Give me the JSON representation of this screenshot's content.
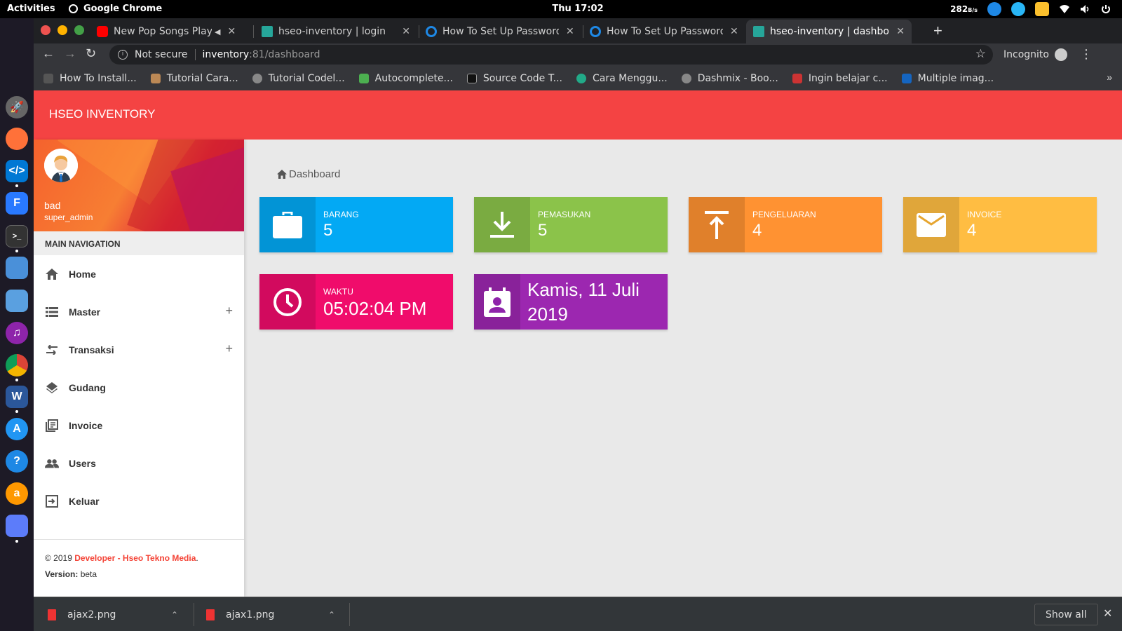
{
  "topbar": {
    "activities": "Activities",
    "app_name": "Google Chrome",
    "clock": "Thu 17:02",
    "net_speed": "282",
    "net_unit": "B/s"
  },
  "dock": {
    "apps": [
      "launcher-icon",
      "firefox-icon",
      "vscode-icon",
      "fman-icon",
      "terminal-icon",
      "screenshot-icon",
      "image-viewer-icon",
      "music-icon",
      "chrome-icon",
      "word-icon",
      "app-store-icon",
      "help-icon",
      "amazon-icon",
      "text-editor-icon"
    ]
  },
  "tabs": [
    {
      "title": "New Pop Songs Playlis",
      "favicon_color": "#ff0000",
      "audio": true
    },
    {
      "title": "hseo-inventory | login",
      "favicon_color": "#e91e63"
    },
    {
      "title": "How To Set Up Password",
      "favicon_color": "#1e88e5"
    },
    {
      "title": "How To Set Up Password",
      "favicon_color": "#1e88e5"
    },
    {
      "title": "hseo-inventory | dashboa",
      "favicon_color": "#e91e63",
      "active": true
    }
  ],
  "omnibox": {
    "security": "Not secure",
    "host": "inventory",
    "path": ":81/dashboard"
  },
  "incognito_label": "Incognito",
  "bookmarks": [
    {
      "label": "How To Install...",
      "color": "#555"
    },
    {
      "label": "Tutorial Cara...",
      "color": "#b85"
    },
    {
      "label": "Tutorial Codel...",
      "color": "#888"
    },
    {
      "label": "Autocomplete...",
      "color": "#4caf50"
    },
    {
      "label": "Source Code T...",
      "color": "#222"
    },
    {
      "label": "Cara Menggu...",
      "color": "#2a8"
    },
    {
      "label": "Dashmix - Boo...",
      "color": "#888"
    },
    {
      "label": "Ingin belajar c...",
      "color": "#c33"
    },
    {
      "label": "Multiple imag...",
      "color": "#1565c0"
    }
  ],
  "app": {
    "brand": "HSEO INVENTORY",
    "user": {
      "name": "bad",
      "role": "super_admin"
    },
    "nav_header": "MAIN NAVIGATION",
    "nav": [
      {
        "label": "Home",
        "icon": "home-icon"
      },
      {
        "label": "Master",
        "icon": "list-icon",
        "expandable": true
      },
      {
        "label": "Transaksi",
        "icon": "swap-icon",
        "expandable": true
      },
      {
        "label": "Gudang",
        "icon": "layers-icon"
      },
      {
        "label": "Invoice",
        "icon": "library-books-icon"
      },
      {
        "label": "Users",
        "icon": "people-icon"
      },
      {
        "label": "Keluar",
        "icon": "exit-icon"
      }
    ],
    "footer": {
      "copyright": "© 2019 ",
      "developer": "Developer - Hseo Tekno Media",
      "period": ".",
      "version_label": "Version:",
      "version_value": " beta"
    },
    "breadcrumb": "Dashboard",
    "cards": [
      {
        "label": "BARANG",
        "value": "5",
        "color": "#03a9f4",
        "icon": "briefcase-icon"
      },
      {
        "label": "PEMASUKAN",
        "value": "5",
        "color": "#8bc34a",
        "icon": "download-icon"
      },
      {
        "label": "PENGELUARAN",
        "value": "4",
        "color": "#ff9232",
        "icon": "upload-icon"
      },
      {
        "label": "INVOICE",
        "value": "4",
        "color": "#ffbd42",
        "icon": "mail-icon"
      },
      {
        "label": "WAKTU",
        "value": "05:02:04 PM",
        "color": "#f00c6b",
        "icon": "clock-icon"
      }
    ],
    "date_card": {
      "line1": "Kamis, 11 Juli",
      "line2": "2019",
      "color": "#9c27b0"
    }
  },
  "shelf": {
    "downloads": [
      "ajax2.png",
      "ajax1.png"
    ],
    "show_all": "Show all"
  }
}
